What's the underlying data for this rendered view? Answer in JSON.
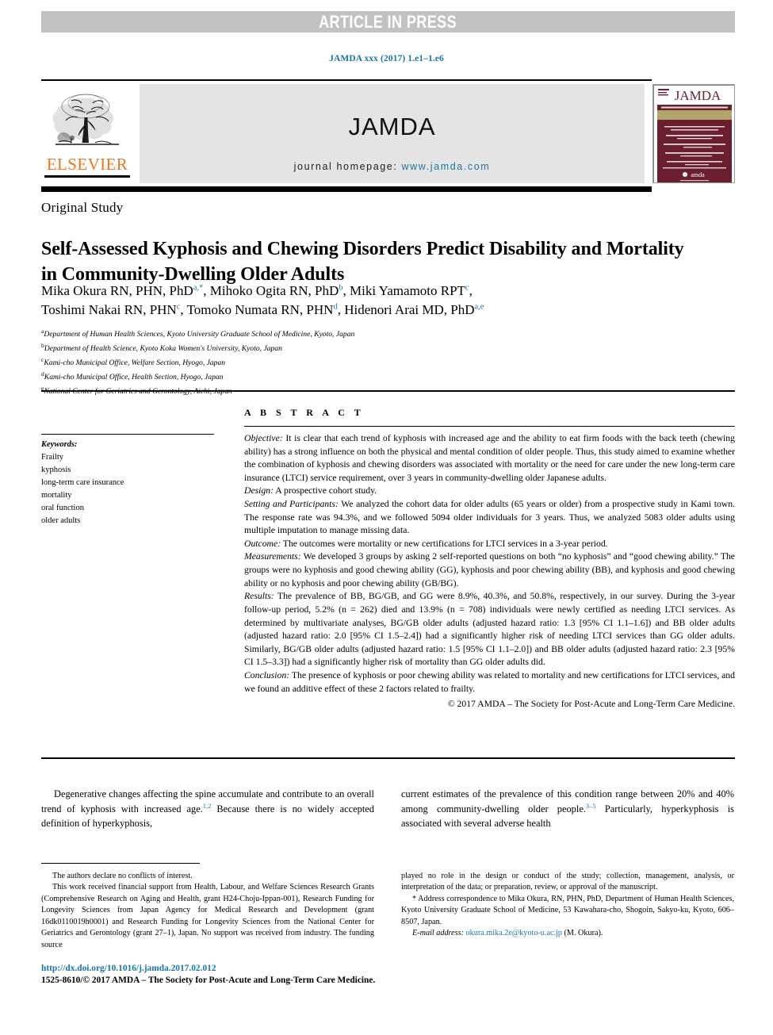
{
  "banner": {
    "text": "ARTICLE IN PRESS"
  },
  "running_head": "JAMDA xxx (2017) 1.e1–1.e6",
  "masthead": {
    "publisher": "ELSEVIER",
    "journal_title": "JAMDA",
    "homepage_label": "journal homepage:",
    "homepage_url": "www.jamda.com",
    "cover_title": "JAMDA"
  },
  "article": {
    "type": "Original Study",
    "title": "Self-Assessed Kyphosis and Chewing Disorders Predict Disability and Mortality in Community-Dwelling Older Adults",
    "authors_line1_a": "Mika Okura RN, PHN, PhD",
    "authors_line1_a_sup": "a,*",
    "authors_line1_b": ", Mihoko Ogita RN, PhD",
    "authors_line1_b_sup": "b",
    "authors_line1_c": ", Miki Yamamoto RPT",
    "authors_line1_c_sup": "c",
    "authors_line1_end": ",",
    "authors_line2_a": "Toshimi Nakai RN, PHN",
    "authors_line2_a_sup": "c",
    "authors_line2_b": ", Tomoko Numata RN, PHN",
    "authors_line2_b_sup": "d",
    "authors_line2_c": ", Hidenori Arai MD, PhD",
    "authors_line2_c_sup": "a,e",
    "affiliations": [
      {
        "marker": "a",
        "text": "Department of Human Health Sciences, Kyoto University Graduate School of Medicine, Kyoto, Japan"
      },
      {
        "marker": "b",
        "text": "Department of Health Science, Kyoto Koka Women's University, Kyoto, Japan"
      },
      {
        "marker": "c",
        "text": "Kami-cho Municipal Office, Welfare Section, Hyogo, Japan"
      },
      {
        "marker": "d",
        "text": "Kami-cho Municipal Office, Health Section, Hyogo, Japan"
      },
      {
        "marker": "e",
        "text": "National Center for Geriatrics and Gerontology, Aichi, Japan"
      }
    ]
  },
  "keywords": {
    "heading": "Keywords:",
    "items": [
      "Frailty",
      "kyphosis",
      "long-term care insurance",
      "mortality",
      "oral function",
      "older adults"
    ]
  },
  "abstract": {
    "heading": "A B S T R A C T",
    "objective_label": "Objective:",
    "objective_text": " It is clear that each trend of kyphosis with increased age and the ability to eat firm foods with the back teeth (chewing ability) has a strong influence on both the physical and mental condition of older people. Thus, this study aimed to examine whether the combination of kyphosis and chewing disorders was associated with mortality or the need for care under the new long-term care insurance (LTCI) service requirement, over 3 years in community-dwelling older Japanese adults.",
    "design_label": "Design:",
    "design_text": " A prospective cohort study.",
    "setting_label": "Setting and Participants:",
    "setting_text": " We analyzed the cohort data for older adults (65 years or older) from a prospective study in Kami town. The response rate was 94.3%, and we followed 5094 older individuals for 3 years. Thus, we analyzed 5083 older adults using multiple imputation to manage missing data.",
    "outcome_label": "Outcome:",
    "outcome_text": " The outcomes were mortality or new certifications for LTCI services in a 3-year period.",
    "measurements_label": "Measurements:",
    "measurements_text": " We developed 3 groups by asking 2 self-reported questions on both “no kyphosis” and “good chewing ability.” The groups were no kyphosis and good chewing ability (GG), kyphosis and poor chewing ability (BB), and kyphosis and good chewing ability or no kyphosis and poor chewing ability (GB/BG).",
    "results_label": "Results:",
    "results_text": " The prevalence of BB, BG/GB, and GG were 8.9%, 40.3%, and 50.8%, respectively, in our survey. During the 3-year follow-up period, 5.2% (n = 262) died and 13.9% (n = 708) individuals were newly certified as needing LTCI services. As determined by multivariate analyses, BG/GB older adults (adjusted hazard ratio: 1.3 [95% CI 1.1–1.6]) and BB older adults (adjusted hazard ratio: 2.0 [95% CI 1.5–2.4]) had a significantly higher risk of needing LTCI services than GG older adults. Similarly, BG/GB older adults (adjusted hazard ratio: 1.5 [95% CI 1.1–2.0]) and BB older adults (adjusted hazard ratio: 2.3 [95% CI 1.5–3.3]) had a significantly higher risk of mortality than GG older adults did.",
    "conclusion_label": "Conclusion:",
    "conclusion_text": " The presence of kyphosis or poor chewing ability was related to mortality and new certifications for LTCI services, and we found an additive effect of these 2 factors related to frailty.",
    "copyright": "© 2017 AMDA – The Society for Post-Acute and Long-Term Care Medicine."
  },
  "body": {
    "left_part1": "Degenerative changes affecting the spine accumulate and contribute to an overall trend of kyphosis with increased age.",
    "left_sup1": "1,2",
    "left_part2": " Because there is no widely accepted definition of hyperkyphosis,",
    "right_part1": "current estimates of the prevalence of this condition range between 20% and 40% among community-dwelling older people.",
    "right_sup1": "3–5",
    "right_part2": " Particularly, hyperkyphosis is associated with several adverse health"
  },
  "footnotes": {
    "conflict": "The authors declare no conflicts of interest.",
    "funding": "This work received financial support from Health, Labour, and Welfare Sciences Research Grants (Comprehensive Research on Aging and Health, grant H24-Choju-Ippan-001), Research Funding for Longevity Sciences from Japan Agency for Medical Research and Development (grant 16dk0110019h0001) and Research Funding for Longevity Sciences from the National Center for Geriatrics and Gerontology (grant 27–1), Japan. No support was received from industry. The funding source",
    "funding_cont": "played no role in the design or conduct of the study; collection, management, analysis, or interpretation of the data; or preparation, review, or approval of the manuscript.",
    "correspondence_marker": "*",
    "correspondence": " Address correspondence to Mika Okura, RN, PHN, PhD, Department of Human Health Sciences, Kyoto University Graduate School of Medicine, 53 Kawahara-cho, Shogoin, Sakyo-ku, Kyoto, 606–8507, Japan.",
    "email_label": "E-mail address:",
    "email": "okura.mika.2e@kyoto-u.ac.jp",
    "email_suffix": " (M. Okura)."
  },
  "footer": {
    "doi": "http://dx.doi.org/10.1016/j.jamda.2017.02.012",
    "issn": "1525-8610/© 2017 AMDA – The Society for Post-Acute and Long-Term Care Medicine."
  },
  "colors": {
    "link": "#1b75a8",
    "elsevier_orange": "#e87722",
    "banner_gray": "#c2c2c2",
    "cover_maroon": "#6b1f2e"
  }
}
